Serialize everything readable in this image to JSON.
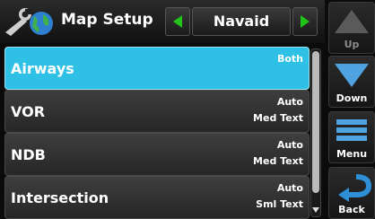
{
  "header": {
    "title": "Map Setup",
    "icon": "wrench-globe-icon",
    "selector_value": "Navaid"
  },
  "rows": [
    {
      "name": "Airways",
      "value_line1": "Both",
      "value_line2": "",
      "selected": true
    },
    {
      "name": "VOR",
      "value_line1": "Auto",
      "value_line2": "Med Text",
      "selected": false
    },
    {
      "name": "NDB",
      "value_line1": "Auto",
      "value_line2": "Med Text",
      "selected": false
    },
    {
      "name": "Intersection",
      "value_line1": "Auto",
      "value_line2": "Sml Text",
      "selected": false
    }
  ],
  "side_buttons": {
    "up": "Up",
    "down": "Down",
    "menu": "Menu",
    "back": "Back"
  },
  "colors": {
    "selected_row": "#2fc0e6",
    "arrow_green": "#22c41a",
    "button_blue": "#2e8fd6"
  }
}
